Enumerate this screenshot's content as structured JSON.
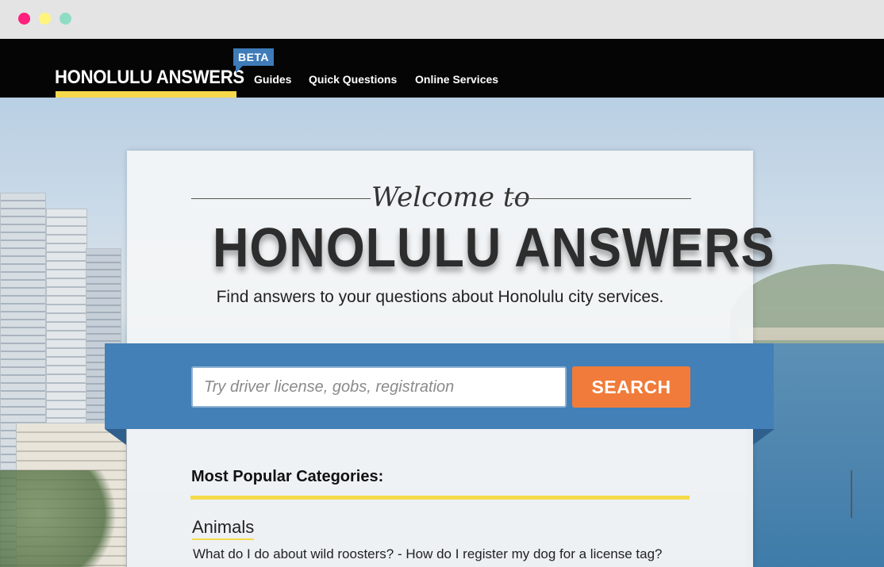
{
  "nav": {
    "logo": "HONOLULU ANSWERS",
    "beta_badge": "BETA",
    "links": [
      "Guides",
      "Quick Questions",
      "Online Services"
    ]
  },
  "hero": {
    "welcome": "Welcome to",
    "title": "HONOLULU ANSWERS",
    "subtitle": "Find answers to your questions about Honolulu city services."
  },
  "search": {
    "placeholder": "Try driver license, gobs, registration",
    "value": "",
    "button_label": "SEARCH"
  },
  "categories": {
    "heading": "Most Popular Categories:",
    "items": [
      {
        "title": "Animals",
        "questions": "What do I do about wild roosters? - How do I register my dog for a license tag?"
      }
    ]
  },
  "colors": {
    "nav_bg": "#050505",
    "accent_yellow": "#f6d94a",
    "banner_blue": "#4380b7",
    "beta_blue": "#3f7bb8",
    "search_orange": "#f07b3a",
    "window_close": "#ff1f7d",
    "window_minimize": "#fff57c",
    "window_zoom": "#8fdcc4"
  }
}
